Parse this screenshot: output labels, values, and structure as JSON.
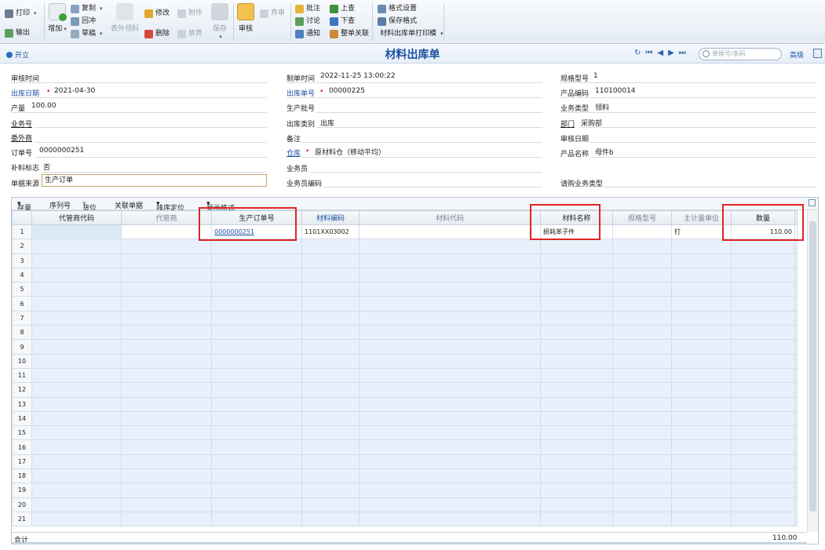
{
  "toolbar": {
    "print": "打印",
    "export": "输出",
    "add": "增加",
    "copy": "复制",
    "revert": "回冲",
    "draft": "草稿",
    "outsource": "表外领料",
    "edit": "修改",
    "attach": "附件",
    "delete": "删除",
    "abandon": "放弃",
    "save": "保存",
    "audit": "审核",
    "unaudit": "弃审",
    "annotate": "批注",
    "discuss": "讨论",
    "notify": "通知",
    "up": "上查",
    "down": "下查",
    "relate": "整单关联",
    "format_settings": "格式设置",
    "save_format": "保存格式",
    "print_template": "材料出库单打印模"
  },
  "titlebar": {
    "open_label": "开立",
    "title": "材料出库单",
    "search_placeholder": "单据号/条码",
    "advanced": "高级"
  },
  "form": {
    "audit_time_label": "审核时间",
    "audit_time": "",
    "create_time_label": "制单时间",
    "create_time": "2022-11-25 13:00:22",
    "spec_label": "规格型号",
    "spec": "1",
    "out_date_label": "出库日期",
    "out_date": "2021-04-30",
    "out_no_label": "出库单号",
    "out_no": "00000225",
    "product_code_label": "产品编码",
    "product_code": "110100014",
    "output_label": "产量",
    "output": "100.00",
    "batch_label": "生产批号",
    "batch": "",
    "biz_type_label": "业务类型",
    "biz_type": "领料",
    "biz_no_label": "业务号",
    "biz_no": "",
    "out_category_label": "出库类别",
    "out_category": "出库",
    "dept_label": "部门",
    "dept": "采购部",
    "outsource_label": "委外商",
    "outsource": "",
    "remark_label": "备注",
    "remark": "",
    "audit_date_label": "审核日期",
    "audit_date": "",
    "order_no_label": "订单号",
    "order_no": "0000000251",
    "warehouse_label": "仓库",
    "warehouse": "原材料仓（移动平均）",
    "product_name_label": "产品名称",
    "product_name": "母件b",
    "supplement_label": "补料标志",
    "supplement": "否",
    "salesman_label": "业务员",
    "salesman": "",
    "source_label": "单据来源",
    "source": "生产订单",
    "salesman_code_label": "业务员编码",
    "salesman_code": "",
    "purchase_type_label": "请购业务类型",
    "purchase_type": ""
  },
  "grid_tools": {
    "stock": "存量",
    "serial": "序列号",
    "location": "货位",
    "related": "关联单据",
    "sort": "排序定位",
    "display": "显示格式"
  },
  "grid": {
    "headers": [
      "代管商代码",
      "代管商",
      "生产订单号",
      "材料编码",
      "材料代码",
      "材料名称",
      "规格型号",
      "主计量单位",
      "数量"
    ],
    "rows": [
      {
        "no": "1",
        "agent_code": "",
        "agent": "",
        "order": "0000000251",
        "mat_code": "1101XX03002",
        "mat_alias": "",
        "mat_name": "损耗苯子件",
        "spec": "",
        "unit": "打",
        "qty": "110.00"
      },
      {
        "no": "2"
      },
      {
        "no": "3"
      },
      {
        "no": "4"
      },
      {
        "no": "5"
      },
      {
        "no": "6"
      },
      {
        "no": "7"
      },
      {
        "no": "8"
      },
      {
        "no": "9"
      },
      {
        "no": "10"
      },
      {
        "no": "11"
      },
      {
        "no": "12"
      },
      {
        "no": "13"
      },
      {
        "no": "14"
      },
      {
        "no": "15"
      },
      {
        "no": "16"
      },
      {
        "no": "17"
      },
      {
        "no": "18"
      },
      {
        "no": "19"
      },
      {
        "no": "20"
      },
      {
        "no": "21"
      }
    ],
    "total_label": "合计",
    "total_qty": "110.00"
  },
  "colors": {
    "accent": "#1b4fa0",
    "highlight": "#e32424",
    "alt_row": "#e8f1fb"
  }
}
